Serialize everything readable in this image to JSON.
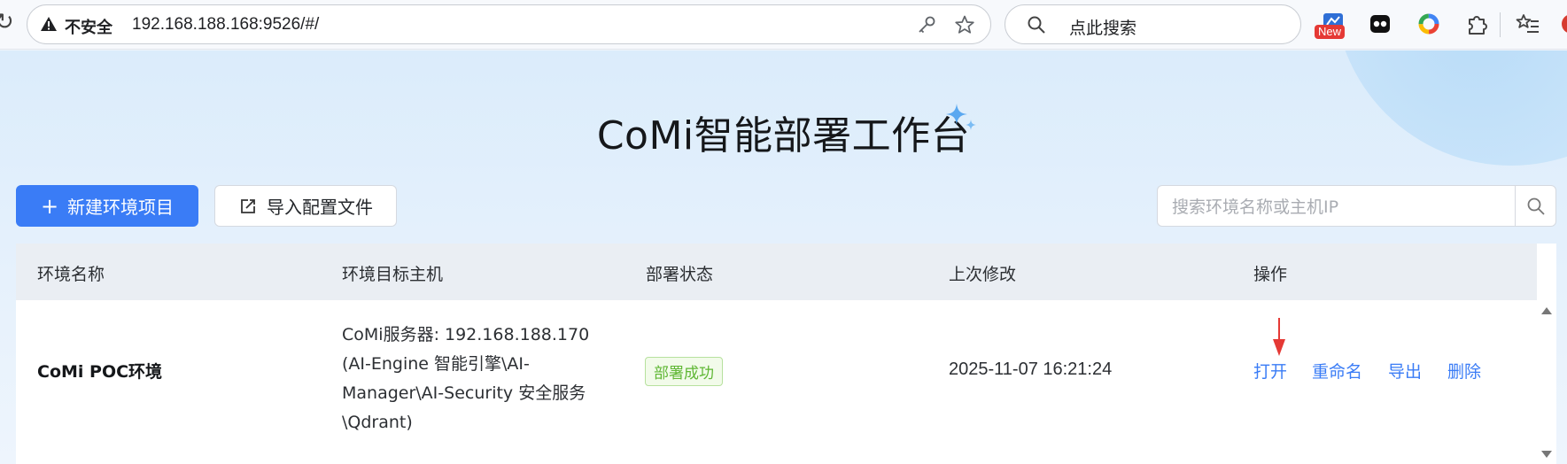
{
  "browser": {
    "security_label": "不安全",
    "url": "192.168.188.168:9526/#/",
    "search_placeholder": "点此搜索",
    "new_badge": "New"
  },
  "page": {
    "title": "CoMi智能部署工作台"
  },
  "toolbar": {
    "new_button": "新建环境项目",
    "import_button": "导入配置文件",
    "search_placeholder": "搜索环境名称或主机IP"
  },
  "table": {
    "columns": [
      "环境名称",
      "环境目标主机",
      "部署状态",
      "上次修改",
      "操作"
    ],
    "rows": [
      {
        "name": "CoMi POC环境",
        "host_lines": [
          "CoMi服务器: 192.168.188.170",
          "(AI-Engine 智能引擎\\AI-",
          "Manager\\AI-Security 安全服务",
          "\\Qdrant)"
        ],
        "status": "部署成功",
        "modified": "2025-11-07 16:21:24",
        "actions": [
          "打开",
          "重命名",
          "导出",
          "删除"
        ]
      }
    ]
  },
  "colors": {
    "accent": "#3a7cf6",
    "success": "#5fb734",
    "annotation_arrow": "#e53935"
  }
}
